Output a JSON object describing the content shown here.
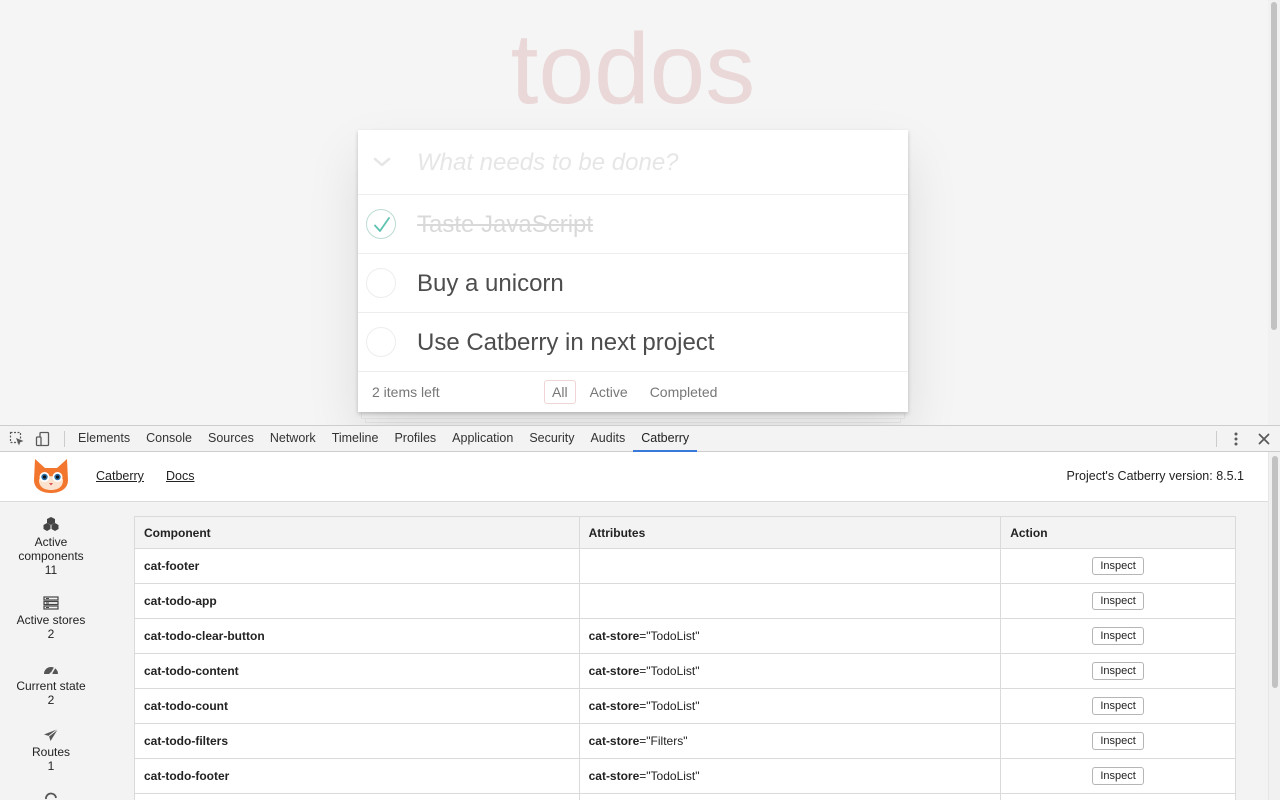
{
  "app": {
    "title": "todos",
    "new_todo_placeholder": "What needs to be done?",
    "todos": [
      {
        "label": "Taste JavaScript",
        "completed": true
      },
      {
        "label": "Buy a unicorn",
        "completed": false
      },
      {
        "label": "Use Catberry in next project",
        "completed": false
      }
    ],
    "items_left": "2 items left",
    "filters": {
      "all": "All",
      "active": "Active",
      "completed": "Completed"
    }
  },
  "devtools": {
    "tabs": {
      "elements": "Elements",
      "console": "Console",
      "sources": "Sources",
      "network": "Network",
      "timeline": "Timeline",
      "profiles": "Profiles",
      "application": "Application",
      "security": "Security",
      "audits": "Audits",
      "catberry": "Catberry"
    },
    "active_tab": "Catberry"
  },
  "catberry": {
    "links": {
      "catberry": "Catberry",
      "docs": "Docs"
    },
    "version_text": "Project's Catberry version: 8.5.1",
    "sidebar": {
      "active_components": {
        "label_line1": "Active",
        "label_line2": "components",
        "count": "11"
      },
      "active_stores": {
        "label": "Active stores",
        "count": "2"
      },
      "current_state": {
        "label": "Current state",
        "count": "2"
      },
      "routes": {
        "label": "Routes",
        "count": "1"
      }
    },
    "table": {
      "headers": {
        "component": "Component",
        "attributes": "Attributes",
        "action": "Action"
      },
      "inspect_label": "Inspect",
      "rows": [
        {
          "component": "cat-footer",
          "attr_key": "",
          "attr_eq": "",
          "attr_value": ""
        },
        {
          "component": "cat-todo-app",
          "attr_key": "",
          "attr_eq": "",
          "attr_value": ""
        },
        {
          "component": "cat-todo-clear-button",
          "attr_key": "cat-store",
          "attr_eq": "=",
          "attr_value": "\"TodoList\""
        },
        {
          "component": "cat-todo-content",
          "attr_key": "cat-store",
          "attr_eq": "=",
          "attr_value": "\"TodoList\""
        },
        {
          "component": "cat-todo-count",
          "attr_key": "cat-store",
          "attr_eq": "=",
          "attr_value": "\"TodoList\""
        },
        {
          "component": "cat-todo-filters",
          "attr_key": "cat-store",
          "attr_eq": "=",
          "attr_value": "\"Filters\""
        },
        {
          "component": "cat-todo-footer",
          "attr_key": "cat-store",
          "attr_eq": "=",
          "attr_value": "\"TodoList\""
        }
      ]
    }
  },
  "colors": {
    "todo_title": "#efd5d5",
    "check_green": "#5dc2af",
    "active_tab_underline": "#3879d9",
    "cat_orange": "#f2762e"
  }
}
